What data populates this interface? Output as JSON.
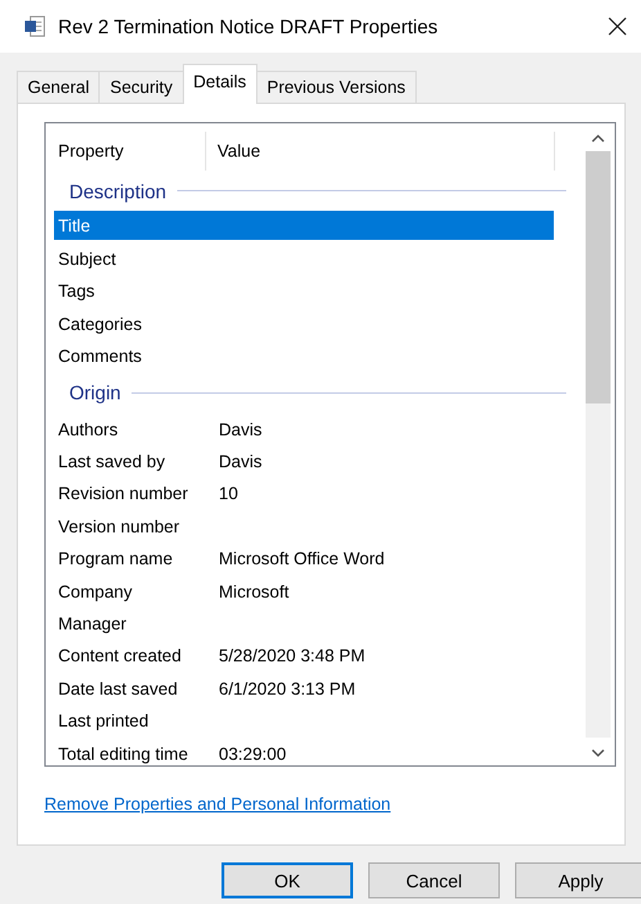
{
  "window": {
    "title": "Rev 2 Termination  Notice DRAFT Properties"
  },
  "tabs": [
    {
      "label": "General",
      "selected": false
    },
    {
      "label": "Security",
      "selected": false
    },
    {
      "label": "Details",
      "selected": true
    },
    {
      "label": "Previous Versions",
      "selected": false
    }
  ],
  "details": {
    "columns": [
      "Property",
      "Value"
    ],
    "sections": [
      {
        "title": "Description",
        "rows": [
          {
            "property": "Title",
            "value": "",
            "selected": true
          },
          {
            "property": "Subject",
            "value": "",
            "selected": false
          },
          {
            "property": "Tags",
            "value": "",
            "selected": false
          },
          {
            "property": "Categories",
            "value": "",
            "selected": false
          },
          {
            "property": "Comments",
            "value": "",
            "selected": false
          }
        ]
      },
      {
        "title": "Origin",
        "rows": [
          {
            "property": "Authors",
            "value": "Davis",
            "selected": false
          },
          {
            "property": "Last saved by",
            "value": "Davis",
            "selected": false
          },
          {
            "property": "Revision number",
            "value": "10",
            "selected": false
          },
          {
            "property": "Version number",
            "value": "",
            "selected": false
          },
          {
            "property": "Program name",
            "value": "Microsoft Office Word",
            "selected": false
          },
          {
            "property": "Company",
            "value": "Microsoft",
            "selected": false
          },
          {
            "property": "Manager",
            "value": "",
            "selected": false
          },
          {
            "property": "Content created",
            "value": "5/28/2020 3:48 PM",
            "selected": false
          },
          {
            "property": "Date last saved",
            "value": "6/1/2020 3:13 PM",
            "selected": false
          },
          {
            "property": "Last printed",
            "value": "",
            "selected": false
          },
          {
            "property": "Total editing time",
            "value": "03:29:00",
            "selected": false
          }
        ]
      }
    ]
  },
  "link": "Remove Properties and Personal Information",
  "buttons": [
    {
      "label": "OK",
      "default": true
    },
    {
      "label": "Cancel",
      "default": false
    },
    {
      "label": "Apply",
      "default": false
    }
  ]
}
